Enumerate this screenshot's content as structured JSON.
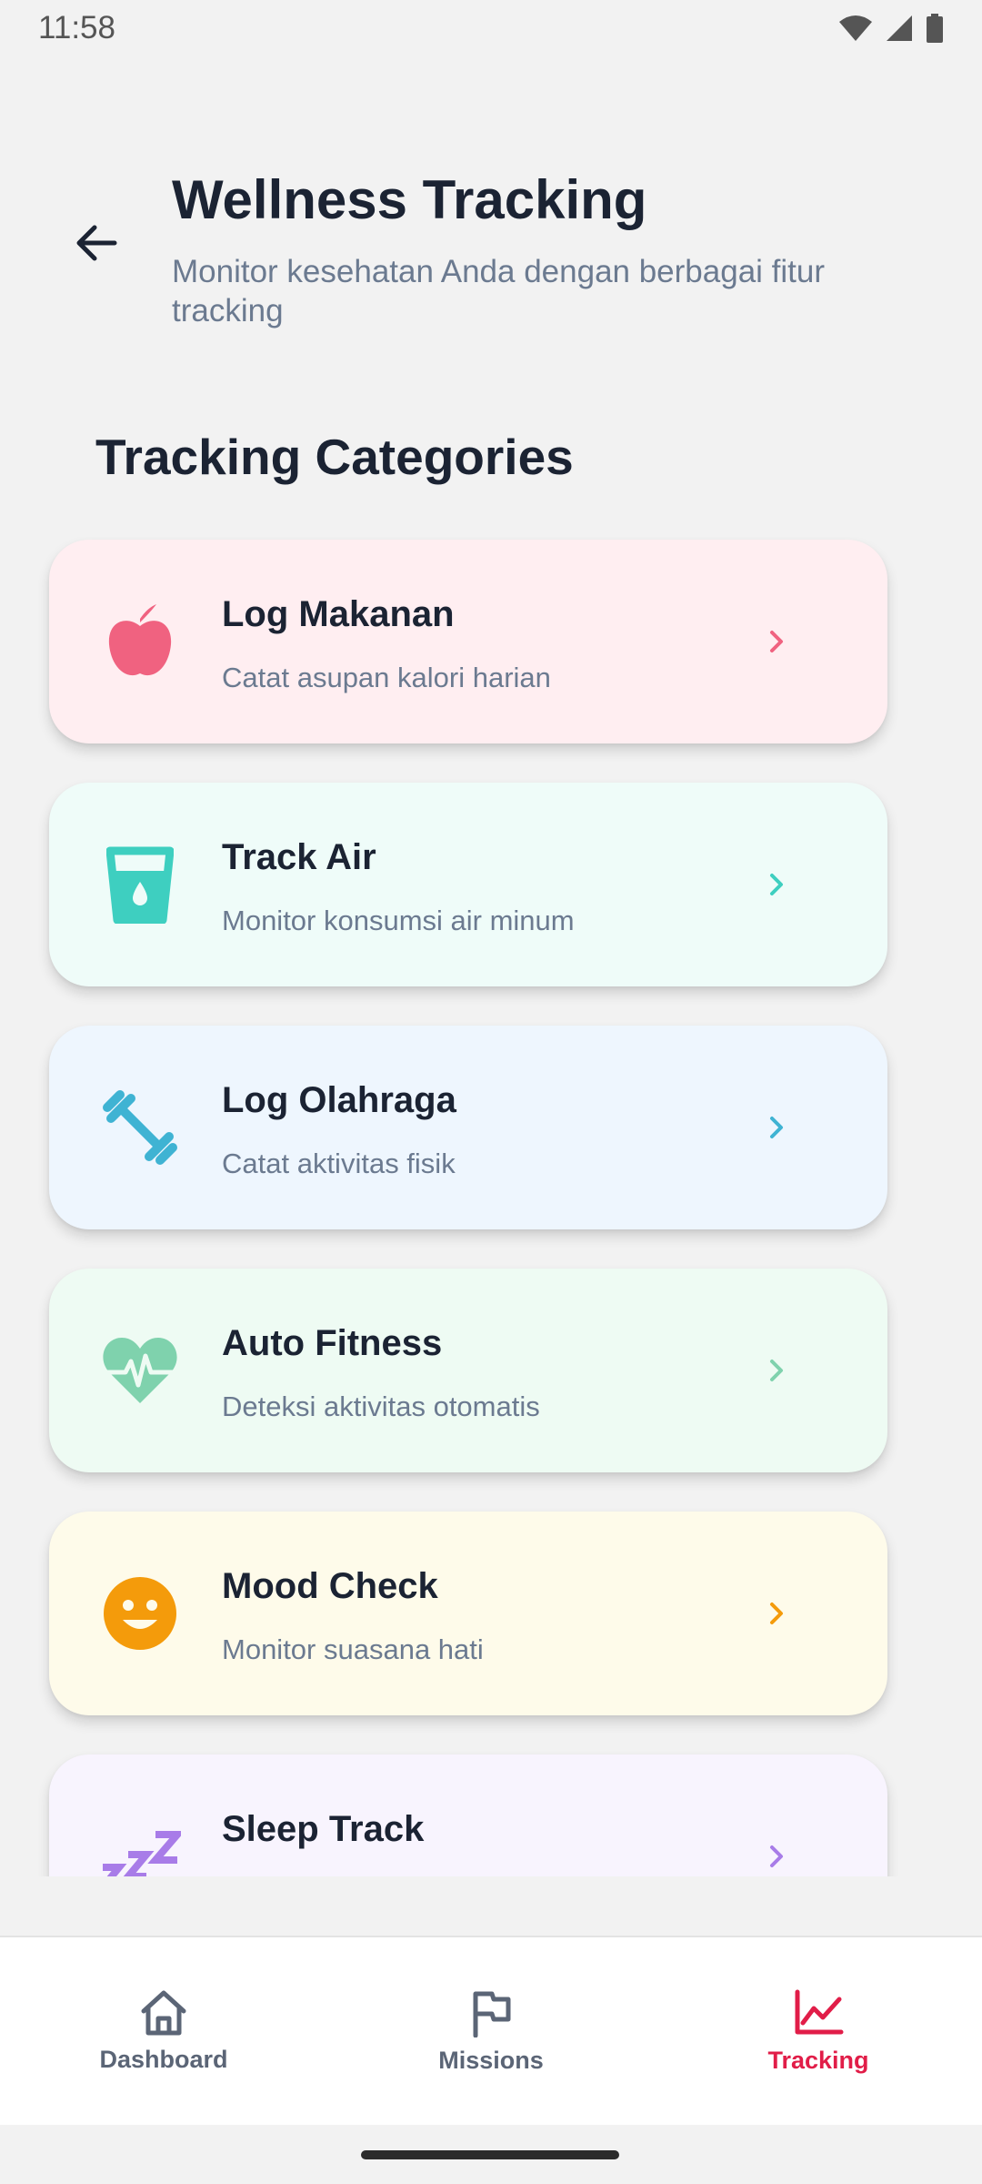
{
  "status_bar": {
    "time": "11:58"
  },
  "header": {
    "title": "Wellness Tracking",
    "subtitle": "Monitor kesehatan Anda dengan berbagai fitur tracking"
  },
  "section_title": "Tracking Categories",
  "cards": [
    {
      "label": "Log Makanan",
      "desc": "Catat asupan kalori harian",
      "icon": "apple-icon",
      "bg": "#ffeef1",
      "accent": "#f06280"
    },
    {
      "label": "Track Air",
      "desc": "Monitor konsumsi air minum",
      "icon": "water-glass-icon",
      "bg": "#effcf9",
      "accent": "#3ecfc0"
    },
    {
      "label": "Log Olahraga",
      "desc": "Catat aktivitas fisik",
      "icon": "dumbbell-icon",
      "bg": "#eef6fe",
      "accent": "#3fb3d3"
    },
    {
      "label": "Auto Fitness",
      "desc": "Deteksi aktivitas otomatis",
      "icon": "heartbeat-icon",
      "bg": "#eefbf3",
      "accent": "#7fd2ad"
    },
    {
      "label": "Mood Check",
      "desc": "Monitor suasana hati",
      "icon": "smiley-icon",
      "bg": "#fefbea",
      "accent": "#f49b0b"
    },
    {
      "label": "Sleep Track",
      "desc": "",
      "icon": "sleep-zzz-icon",
      "bg": "#f8f4fe",
      "accent": "#a87ce8"
    }
  ],
  "nav": {
    "items": [
      {
        "label": "Dashboard",
        "icon": "home-icon",
        "active": false
      },
      {
        "label": "Missions",
        "icon": "flag-icon",
        "active": false
      },
      {
        "label": "Tracking",
        "icon": "chart-line-icon",
        "active": true
      }
    ],
    "active_color": "#e11d48",
    "inactive_color": "#5b6576"
  }
}
